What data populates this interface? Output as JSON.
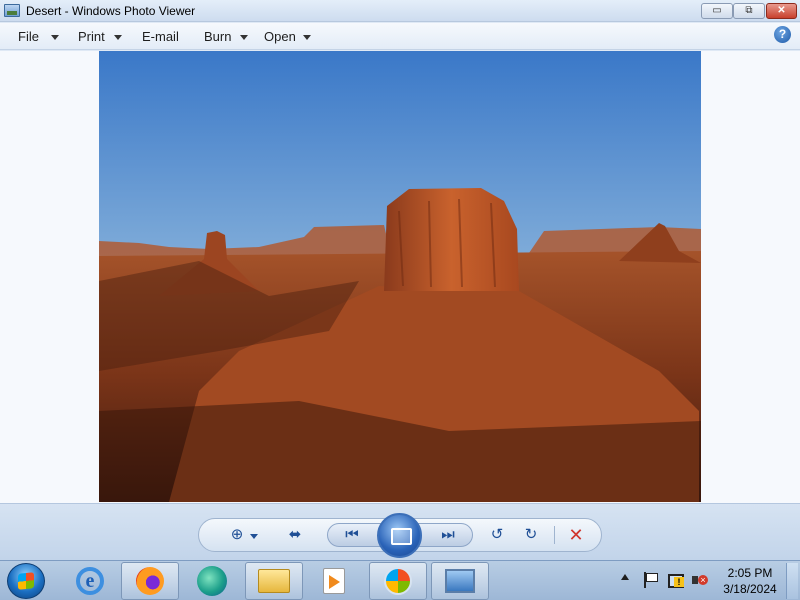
{
  "window": {
    "title": "Desert - Windows Photo Viewer",
    "controls": {
      "minimize": "▭",
      "maximize": "⧉",
      "close": "✕"
    }
  },
  "menu": {
    "items": [
      {
        "label": "File",
        "has_dropdown": true
      },
      {
        "label": "Print",
        "has_dropdown": true
      },
      {
        "label": "E-mail",
        "has_dropdown": false
      },
      {
        "label": "Burn",
        "has_dropdown": true
      },
      {
        "label": "Open",
        "has_dropdown": true
      }
    ],
    "help_glyph": "?"
  },
  "photo": {
    "subject": "Desert"
  },
  "controls": {
    "buttons": [
      "zoom-icon",
      "actual-size-icon",
      "previous-icon",
      "slideshow-icon",
      "next-icon",
      "rotate-left-icon",
      "rotate-right-icon",
      "delete-icon"
    ]
  },
  "taskbar": {
    "items": [
      "start-orb",
      "internet-explorer-icon",
      "firefox-icon",
      "edge-icon",
      "file-explorer-icon",
      "media-player-icon",
      "windows-icon",
      "photo-viewer-icon"
    ],
    "clock": {
      "time": "2:05 PM",
      "date": "3/18/2024"
    }
  },
  "colors": {
    "accent": "#1f4f96",
    "delete": "#d0342c",
    "close_button": "#c8402c"
  }
}
